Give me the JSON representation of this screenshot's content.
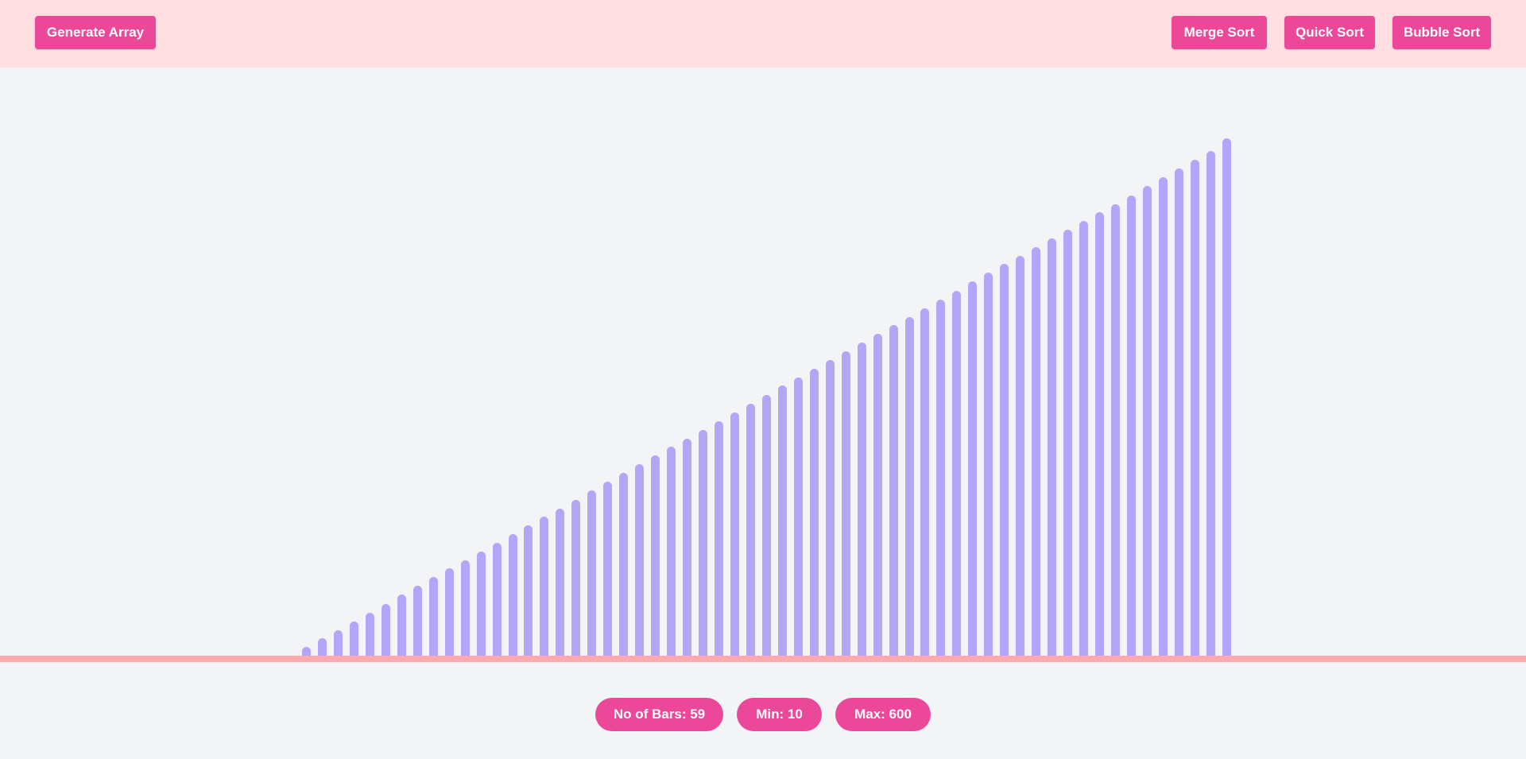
{
  "toolbar": {
    "generate_label": "Generate Array",
    "merge_label": "Merge Sort",
    "quick_label": "Quick Sort",
    "bubble_label": "Bubble Sort"
  },
  "stats": {
    "bars_label": "No of Bars: 59",
    "min_label": "Min: 10",
    "max_label": "Max: 600"
  },
  "colors": {
    "accent": "#ec4899",
    "header_bg": "#ffdfe1",
    "bar": "#b3a6f8",
    "baseline": "#fcaaad",
    "page_bg": "#f3f4f6"
  },
  "chart_data": {
    "type": "bar",
    "values": [
      10,
      20,
      30,
      40,
      50,
      60,
      71,
      81,
      91,
      101,
      111,
      121,
      131,
      141,
      151,
      161,
      171,
      181,
      192,
      202,
      212,
      222,
      232,
      242,
      252,
      262,
      272,
      282,
      292,
      302,
      313,
      323,
      333,
      343,
      353,
      363,
      373,
      383,
      393,
      403,
      413,
      423,
      434,
      444,
      454,
      464,
      474,
      484,
      494,
      504,
      514,
      524,
      534,
      545,
      555,
      565,
      575,
      585,
      600
    ],
    "ylim": [
      0,
      600
    ],
    "grid": false,
    "legend": "none"
  }
}
